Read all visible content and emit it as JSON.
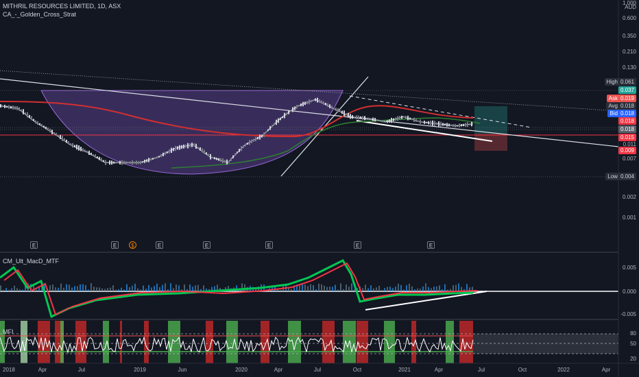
{
  "header": {
    "symbol_line": "MITHRIL RESOURCES LIMITED, 1D, ASX",
    "strategy": "CA_-_Golden_Cross_Strat"
  },
  "price_axis": {
    "currency": "AUD",
    "ticks": [
      "1.000",
      "0.600",
      "0.350",
      "0.210",
      "0.130",
      "0.011",
      "0.007",
      "0.002",
      "0.001"
    ]
  },
  "price_tags": [
    {
      "key": "High",
      "value": "0.061",
      "color": "#2a2e39",
      "text_color": "#d1d4dc"
    },
    {
      "key": "",
      "value": "0.037",
      "color": "#26a69a",
      "text_color": "#ffffff"
    },
    {
      "key": "Ask",
      "value": "0.019",
      "color": "#ef5350",
      "text_color": "#ffffff"
    },
    {
      "key": "Avg",
      "value": "0.018",
      "color": "#2a2e39",
      "text_color": "#d1d4dc"
    },
    {
      "key": "Bid",
      "value": "0.018",
      "color": "#2962ff",
      "text_color": "#ffffff"
    },
    {
      "key": "",
      "value": "0.018",
      "color": "#f23645",
      "text_color": "#ffffff"
    },
    {
      "key": "",
      "value": "0.018",
      "color": "#5d606b",
      "text_color": "#ffffff"
    },
    {
      "key": "",
      "value": "0.015",
      "color": "#f23645",
      "text_color": "#ffffff"
    },
    {
      "key": "",
      "value": "0.009",
      "color": "#f23645",
      "text_color": "#ffffff"
    },
    {
      "key": "Low",
      "value": "0.004",
      "color": "#2a2e39",
      "text_color": "#d1d4dc"
    }
  ],
  "events": [
    {
      "symbol": "E",
      "type": "earnings"
    },
    {
      "symbol": "E",
      "type": "earnings"
    },
    {
      "symbol": "$",
      "type": "dividend"
    },
    {
      "symbol": "E",
      "type": "earnings"
    },
    {
      "symbol": "E",
      "type": "earnings"
    },
    {
      "symbol": "E",
      "type": "earnings"
    },
    {
      "symbol": "E",
      "type": "earnings"
    },
    {
      "symbol": "E",
      "type": "earnings"
    }
  ],
  "indicator_macd": {
    "label": "CM_Ult_MacD_MTF",
    "ticks": [
      "0.005",
      "0.000",
      "-0.005"
    ]
  },
  "indicator_mfi": {
    "label": "MFI",
    "ticks": [
      "80",
      "50",
      "20"
    ]
  },
  "time_axis": [
    "2018",
    "Apr",
    "Jul",
    "2019",
    "Jun",
    "2020",
    "Apr",
    "Jul",
    "Oct",
    "2021",
    "Apr",
    "Jul",
    "Oct",
    "2022",
    "Apr"
  ],
  "chart_data": {
    "type": "line",
    "title": "MITHRIL RESOURCES LIMITED, 1D, ASX",
    "scale": "log",
    "x": [
      "2018-01",
      "2018-03",
      "2018-06",
      "2018-09",
      "2018-11",
      "2019-01",
      "2019-03",
      "2019-05",
      "2019-07",
      "2019-09",
      "2019-11",
      "2020-01",
      "2020-03",
      "2020-04",
      "2020-05",
      "2020-06",
      "2020-07",
      "2020-08",
      "2020-09",
      "2020-10",
      "2020-11",
      "2020-12",
      "2021-01",
      "2021-02",
      "2021-03",
      "2021-04",
      "2021-05",
      "2021-06"
    ],
    "series": [
      {
        "values": [
          0.03,
          0.028,
          0.019,
          0.014,
          0.01,
          0.008,
          0.006,
          0.006,
          0.006,
          0.007,
          0.009,
          0.01,
          0.007,
          0.006,
          0.01,
          0.013,
          0.021,
          0.03,
          0.036,
          0.028,
          0.022,
          0.021,
          0.019,
          0.022,
          0.019,
          0.018,
          0.017,
          0.018
        ]
      }
    ],
    "ylim": [
      0.001,
      1.0
    ]
  }
}
